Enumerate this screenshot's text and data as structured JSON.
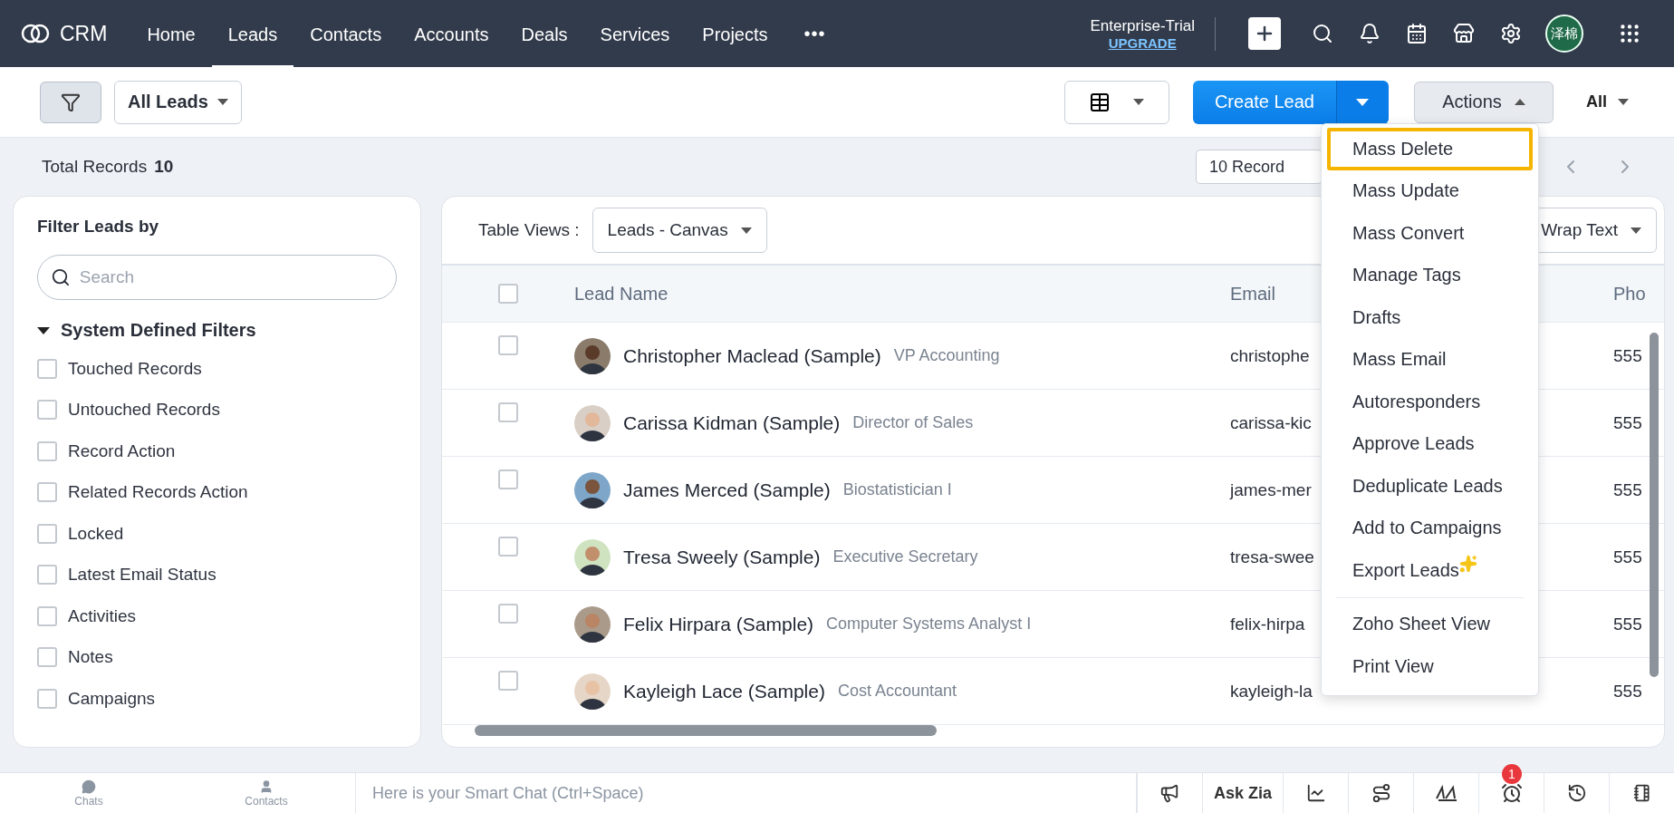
{
  "nav": {
    "brand": "CRM",
    "tabs": [
      {
        "label": "Home",
        "selected": false
      },
      {
        "label": "Leads",
        "selected": true
      },
      {
        "label": "Contacts",
        "selected": false
      },
      {
        "label": "Accounts",
        "selected": false
      },
      {
        "label": "Deals",
        "selected": false
      },
      {
        "label": "Services",
        "selected": false
      },
      {
        "label": "Projects",
        "selected": false
      }
    ],
    "more": "•••",
    "plan": "Enterprise-Trial",
    "upgrade": "UPGRADE",
    "avatar": "泽棉"
  },
  "toolbar": {
    "filter_selected": true,
    "view": "All Leads",
    "create": "Create Lead",
    "actions": "Actions",
    "actions_expanded": true,
    "scope": "All"
  },
  "summary": {
    "label": "Total Records",
    "count": "10",
    "per_page": "10 Record"
  },
  "filters": {
    "title": "Filter Leads by",
    "search_placeholder": "Search",
    "section": "System Defined Filters",
    "expanded": true,
    "items": [
      {
        "label": "Touched Records",
        "checked": false
      },
      {
        "label": "Untouched Records",
        "checked": false
      },
      {
        "label": "Record Action",
        "checked": false
      },
      {
        "label": "Related Records Action",
        "checked": false
      },
      {
        "label": "Locked",
        "checked": false
      },
      {
        "label": "Latest Email Status",
        "checked": false
      },
      {
        "label": "Activities",
        "checked": false
      },
      {
        "label": "Notes",
        "checked": false
      },
      {
        "label": "Campaigns",
        "checked": false
      }
    ]
  },
  "table": {
    "select_all": false,
    "views_label": "Table Views :",
    "view": "Leads - Canvas",
    "wrap": "Wrap Text",
    "columns": [
      "Lead Name",
      "Email",
      "Pho"
    ],
    "rows": [
      {
        "name": "Christopher Maclead (Sample)",
        "title": "VP Accounting",
        "email": "christophe",
        "phone": "555",
        "checked": false
      },
      {
        "name": "Carissa Kidman (Sample)",
        "title": "Director of Sales",
        "email": "carissa-kic",
        "phone": "555",
        "checked": false
      },
      {
        "name": "James Merced (Sample)",
        "title": "Biostatistician I",
        "email": "james-mer",
        "phone": "555",
        "checked": false
      },
      {
        "name": "Tresa Sweely (Sample)",
        "title": "Executive Secretary",
        "email": "tresa-swee",
        "phone": "555",
        "checked": false
      },
      {
        "name": "Felix Hirpara (Sample)",
        "title": "Computer Systems Analyst I",
        "email": "felix-hirpa",
        "phone": "555",
        "checked": false
      },
      {
        "name": "Kayleigh Lace (Sample)",
        "title": "Cost Accountant",
        "email": "kayleigh-la",
        "phone": "555",
        "checked": false
      }
    ]
  },
  "actions_menu": {
    "groups": [
      [
        {
          "label": "Mass Delete",
          "selected": true
        },
        {
          "label": "Mass Update",
          "selected": false
        },
        {
          "label": "Mass Convert",
          "selected": false
        },
        {
          "label": "Manage Tags",
          "selected": false
        },
        {
          "label": "Drafts",
          "selected": false
        },
        {
          "label": "Mass Email",
          "selected": false
        },
        {
          "label": "Autoresponders",
          "selected": false
        },
        {
          "label": "Approve Leads",
          "selected": false
        },
        {
          "label": "Deduplicate Leads",
          "selected": false
        },
        {
          "label": "Add to Campaigns",
          "selected": false
        },
        {
          "label": "Export Leads",
          "selected": false,
          "sparkle": true
        }
      ],
      [
        {
          "label": "Zoho Sheet View",
          "selected": false
        },
        {
          "label": "Print View",
          "selected": false
        }
      ]
    ]
  },
  "bottom": {
    "chats": "Chats",
    "contacts": "Contacts",
    "chat_placeholder": "Here is your Smart Chat (Ctrl+Space)",
    "zia": "Ask Zia",
    "alarm_badge": "1"
  }
}
